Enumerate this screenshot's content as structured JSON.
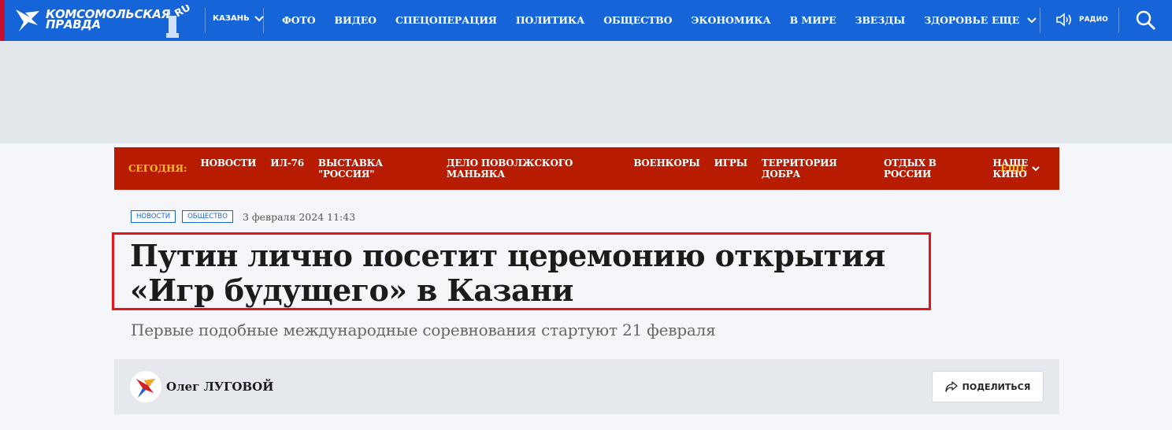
{
  "header": {
    "logo_text": "КОМСОМОЛЬСКАЯ\nПРАВДА",
    "logo_badge": "RU",
    "city": "КАЗАНЬ",
    "nav": [
      "ФОТО",
      "ВИДЕО",
      "СПЕЦОПЕРАЦИЯ",
      "ПОЛИТИКА",
      "ОБЩЕСТВО",
      "ЭКОНОМИКА",
      "В МИРЕ",
      "ЗВЕЗДЫ",
      "ЗДОРОВЬЕ"
    ],
    "more_label": "ЕЩЕ",
    "radio_label": "РАДИО",
    "icons": {
      "search": "search-icon",
      "radio": "speaker-icon",
      "chevron": "chevron-down-icon"
    }
  },
  "section_nav": {
    "today_label": "СЕГОДНЯ:",
    "items": [
      "НОВОСТИ",
      "ИЛ-76",
      "ВЫСТАВКА \"РОССИЯ\"",
      "ДЕЛО ПОВОЛЖСКОГО МАНЬЯКА",
      "ВОЕНКОРЫ",
      "ИГРЫ",
      "ТЕРРИТОРИЯ ДОБРА",
      "ОТДЫХ В РОССИИ",
      "НАШЕ КИНО"
    ],
    "more_label": "ЕЩЕ"
  },
  "article": {
    "tags": [
      "НОВОСТИ",
      "ОБЩЕСТВО"
    ],
    "date": "3 февраля 2024 11:43",
    "title": "Путин лично посетит церемонию открытия «Игр будущего» в Казани",
    "lead": "Первые подобные международные соревнования стартуют 21 февраля",
    "author": "Олег ЛУГОВОЙ",
    "share_label": "ПОДЕЛИТЬСЯ"
  },
  "colors": {
    "header_bg": "#1564d8",
    "section_nav_bg": "#b71c01",
    "accent_yellow": "#ffc21a",
    "highlight_border": "#e8141c"
  }
}
